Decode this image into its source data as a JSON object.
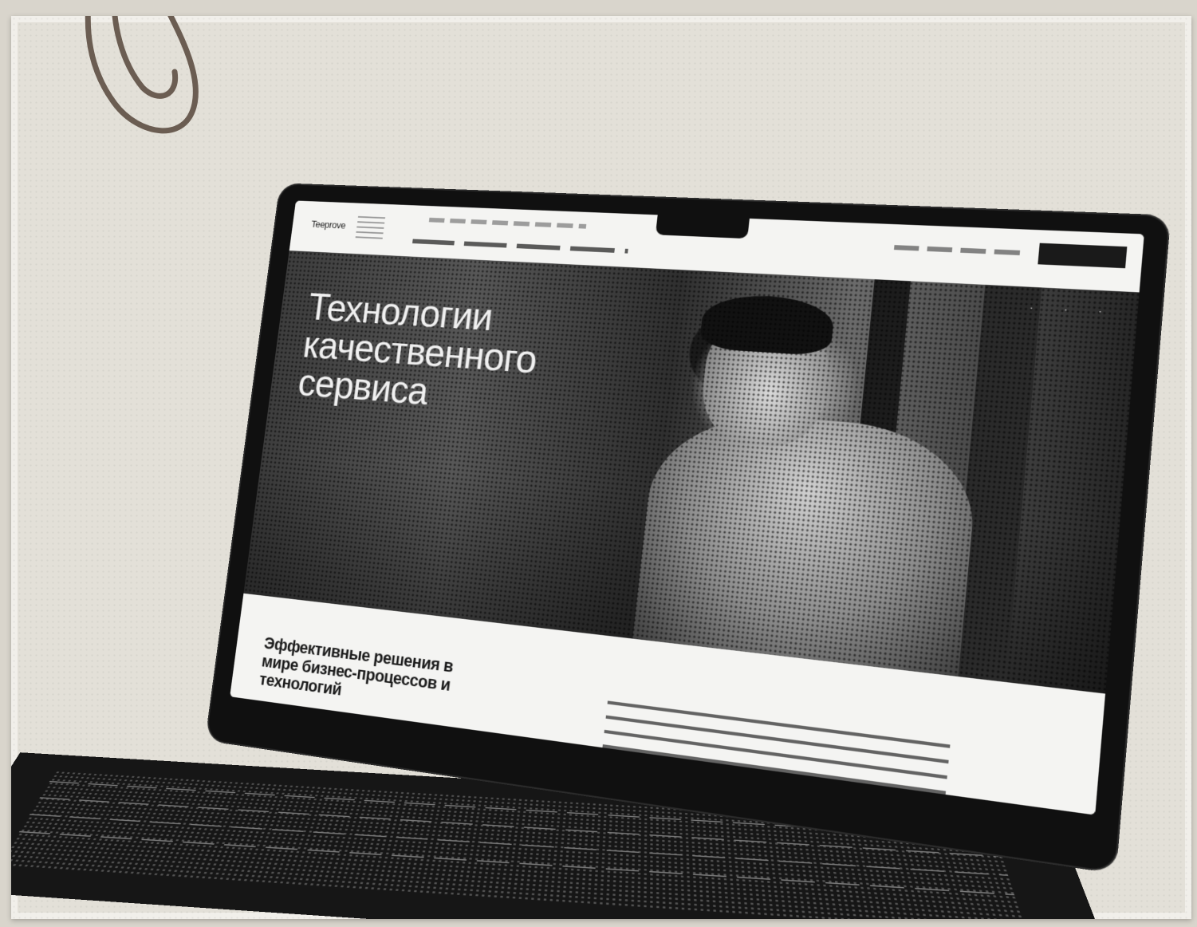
{
  "photo": {
    "subject": "laptop displaying a corporate website, halftone print effect",
    "background_color": "#e3e0d8",
    "accent_color": "#6b5d52"
  },
  "site": {
    "logo_text": "Teeprove",
    "hero_title": "Технологии качественного сервиса",
    "intro_heading": "Эффективные решения в мире бизнес-процессов и технологий"
  },
  "icons": {
    "paperclip": "paperclip-icon"
  }
}
